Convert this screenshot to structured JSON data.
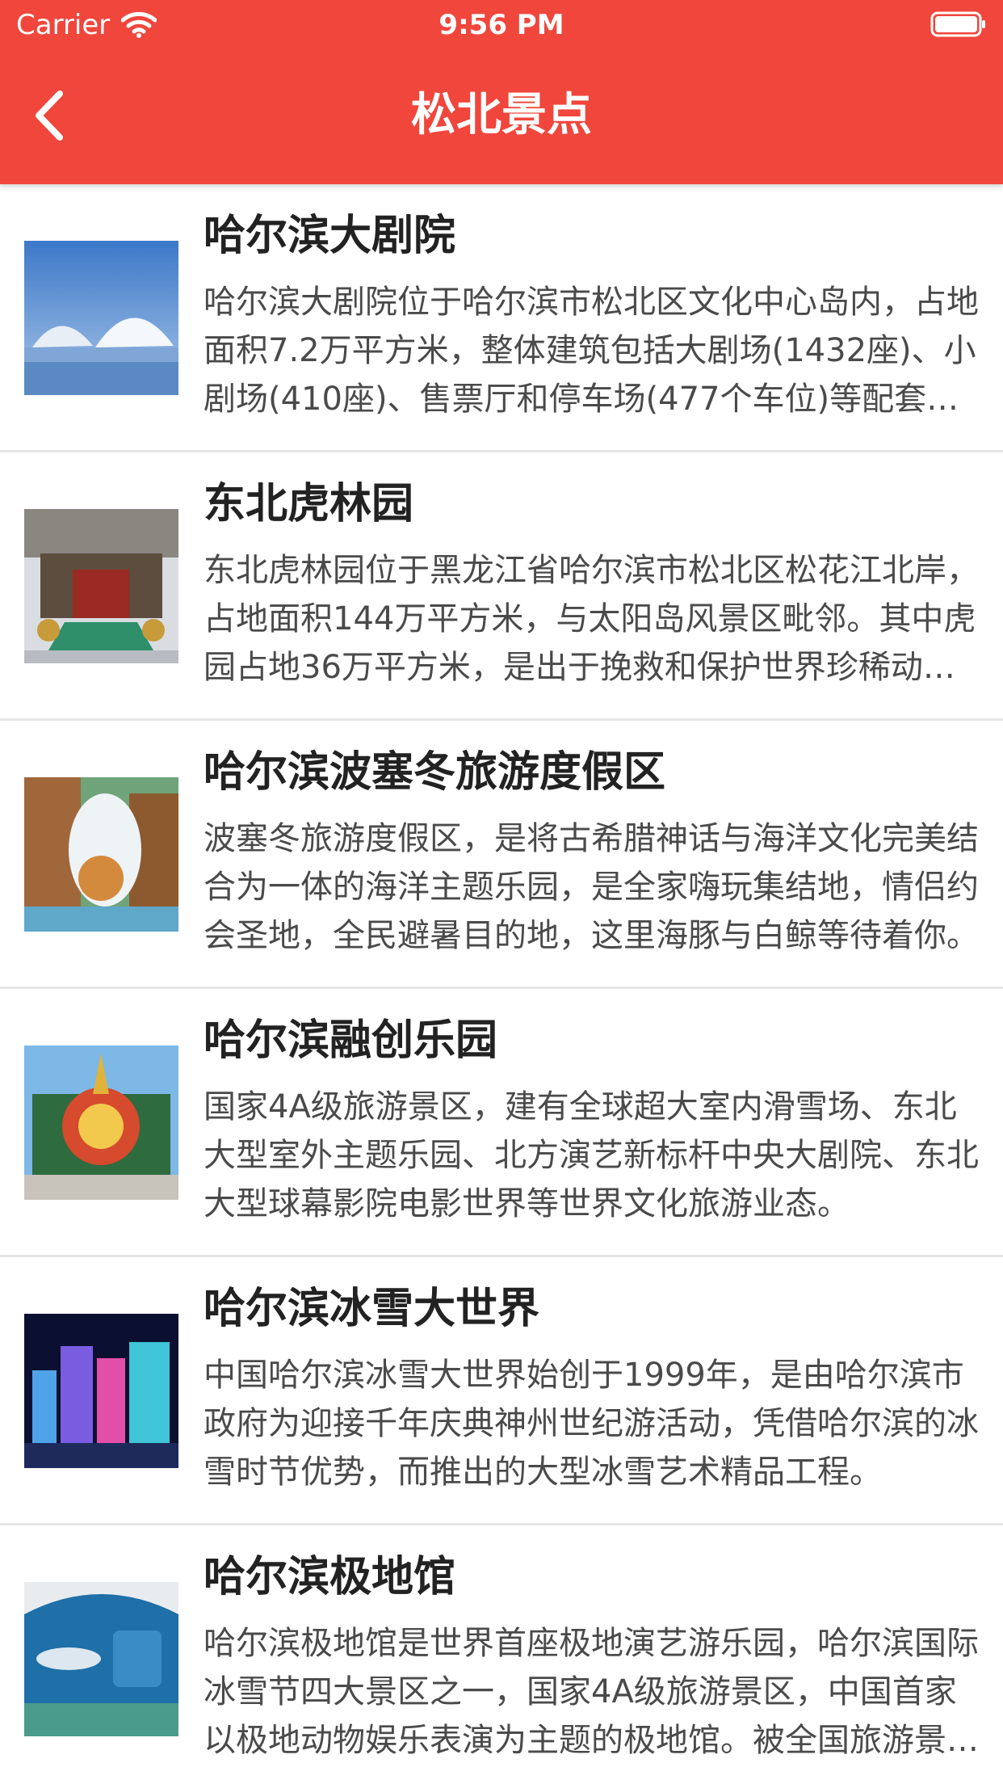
{
  "status_bar": {
    "carrier": "Carrier",
    "time": "9:56 PM"
  },
  "nav": {
    "title": "松北景点",
    "back_icon": "chevron-left-icon"
  },
  "colors": {
    "header_bg": "#f0463c",
    "title_text": "#222222",
    "desc_text": "#4a4a4a",
    "divider": "#e6e6e6"
  },
  "items": [
    {
      "title": "哈尔滨大剧院",
      "description": "哈尔滨大剧院位于哈尔滨市松北区文化中心岛内，占地面积7.2万平方米，整体建筑包括大剧场(1432座)、小剧场(410座)、售票厅和停车场(477个车位)等配套设施。"
    },
    {
      "title": "东北虎林园",
      "description": "东北虎林园位于黑龙江省哈尔滨市松北区松花江北岸，占地面积144万平方米，与太阳岛风景区毗邻。其中虎园占地36万平方米，是出于挽救和保护世界珍稀动物东北虎而建立的。"
    },
    {
      "title": "哈尔滨波塞冬旅游度假区",
      "description": "波塞冬旅游度假区，是将古希腊神话与海洋文化完美结合为一体的海洋主题乐园，是全家嗨玩集结地，情侣约会圣地，全民避暑目的地，这里海豚与白鲸等待着你。"
    },
    {
      "title": "哈尔滨融创乐园",
      "description": "国家4A级旅游景区，建有全球超大室内滑雪场、东北大型室外主题乐园、北方演艺新标杆中央大剧院、东北大型球幕影院电影世界等世界文化旅游业态。"
    },
    {
      "title": "哈尔滨冰雪大世界",
      "description": "中国哈尔滨冰雪大世界始创于1999年，是由哈尔滨市政府为迎接千年庆典神州世纪游活动，凭借哈尔滨的冰雪时节优势，而推出的大型冰雪艺术精品工程。"
    },
    {
      "title": "哈尔滨极地馆",
      "description": "哈尔滨极地馆是世界首座极地演艺游乐园，哈尔滨国际冰雪节四大景区之一，国家4A级旅游景区，中国首家以极地动物娱乐表演为主题的极地馆。被全国旅游景区质量等级评定委员会评定。"
    }
  ]
}
